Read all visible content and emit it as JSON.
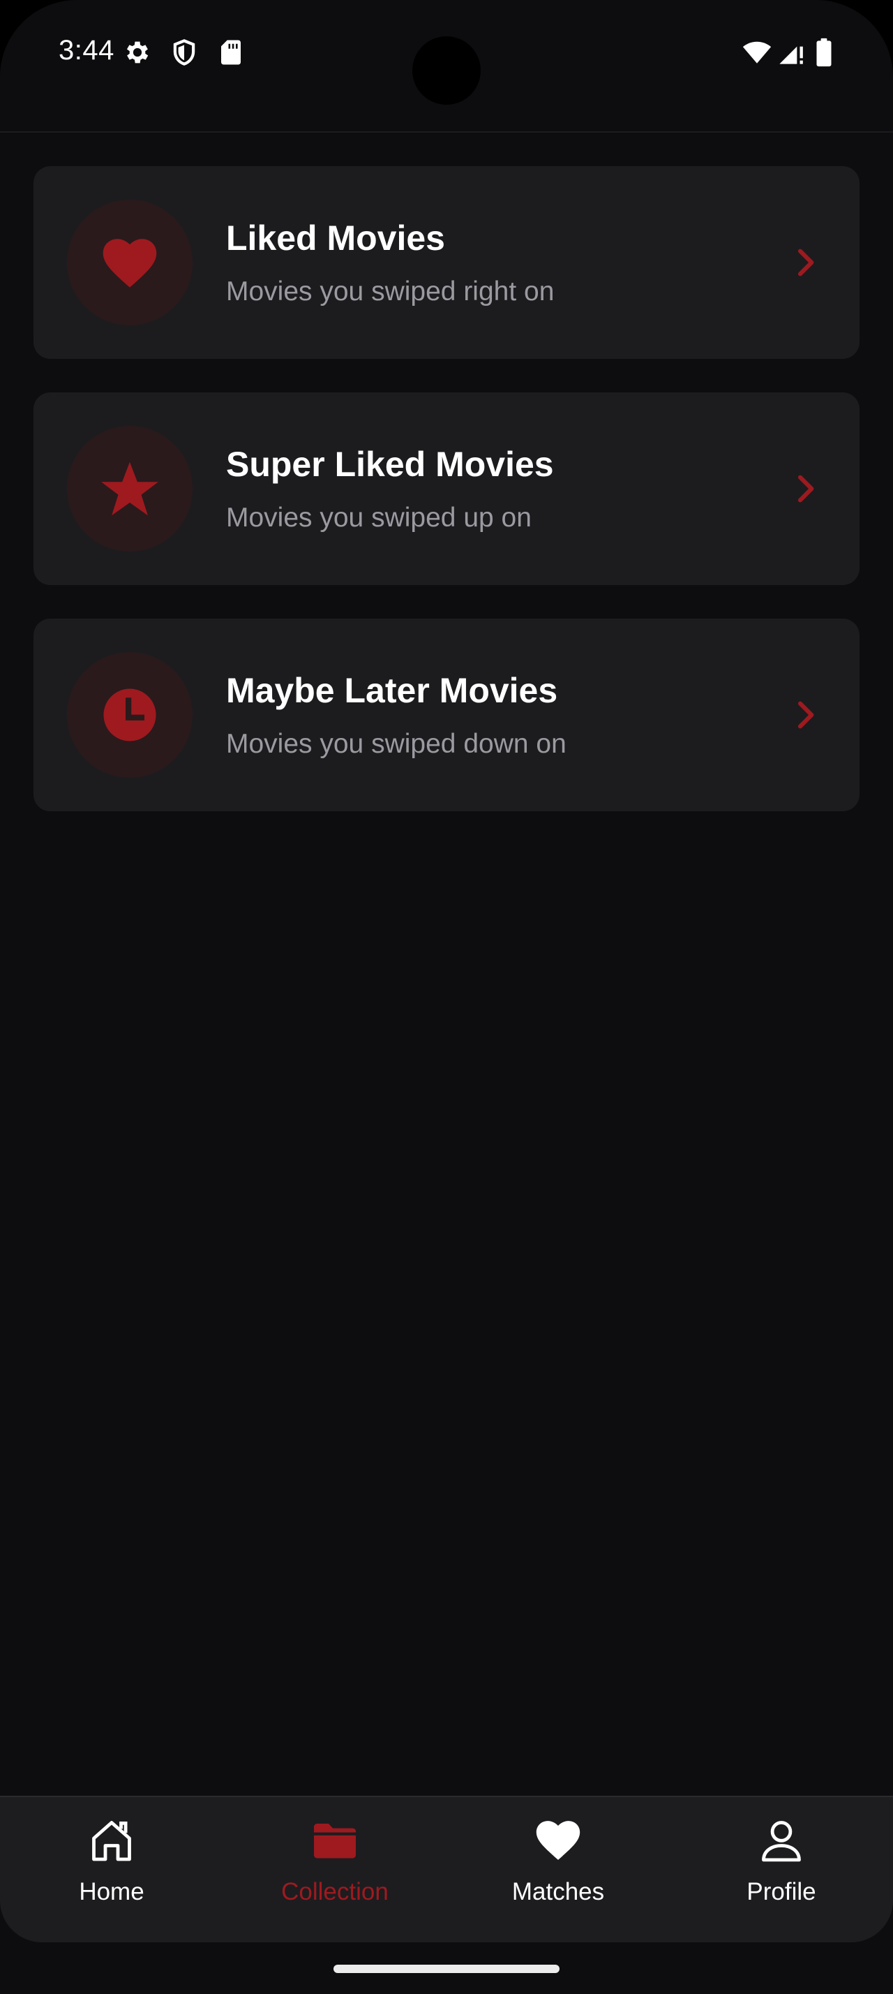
{
  "status_bar": {
    "time": "3:44",
    "icons": [
      "settings-icon",
      "shield-icon",
      "sd-card-icon",
      "wifi-icon",
      "cellular-signal-icon",
      "battery-icon"
    ]
  },
  "theme": {
    "accent": "#9e1a1f",
    "background": "#0d0d0f",
    "card_background": "#1c1c1f",
    "nav_background": "#1d1d20"
  },
  "collections": [
    {
      "title": "Liked Movies",
      "subtitle": "Movies you swiped right on",
      "icon": "heart-icon"
    },
    {
      "title": "Super Liked Movies",
      "subtitle": "Movies you swiped up on",
      "icon": "star-icon"
    },
    {
      "title": "Maybe Later Movies",
      "subtitle": "Movies you swiped down on",
      "icon": "clock-icon"
    }
  ],
  "bottom_nav": {
    "items": [
      {
        "label": "Home",
        "icon": "home-icon",
        "active": false
      },
      {
        "label": "Collection",
        "icon": "folder-icon",
        "active": true
      },
      {
        "label": "Matches",
        "icon": "heart-icon",
        "active": false
      },
      {
        "label": "Profile",
        "icon": "person-icon",
        "active": false
      }
    ]
  }
}
